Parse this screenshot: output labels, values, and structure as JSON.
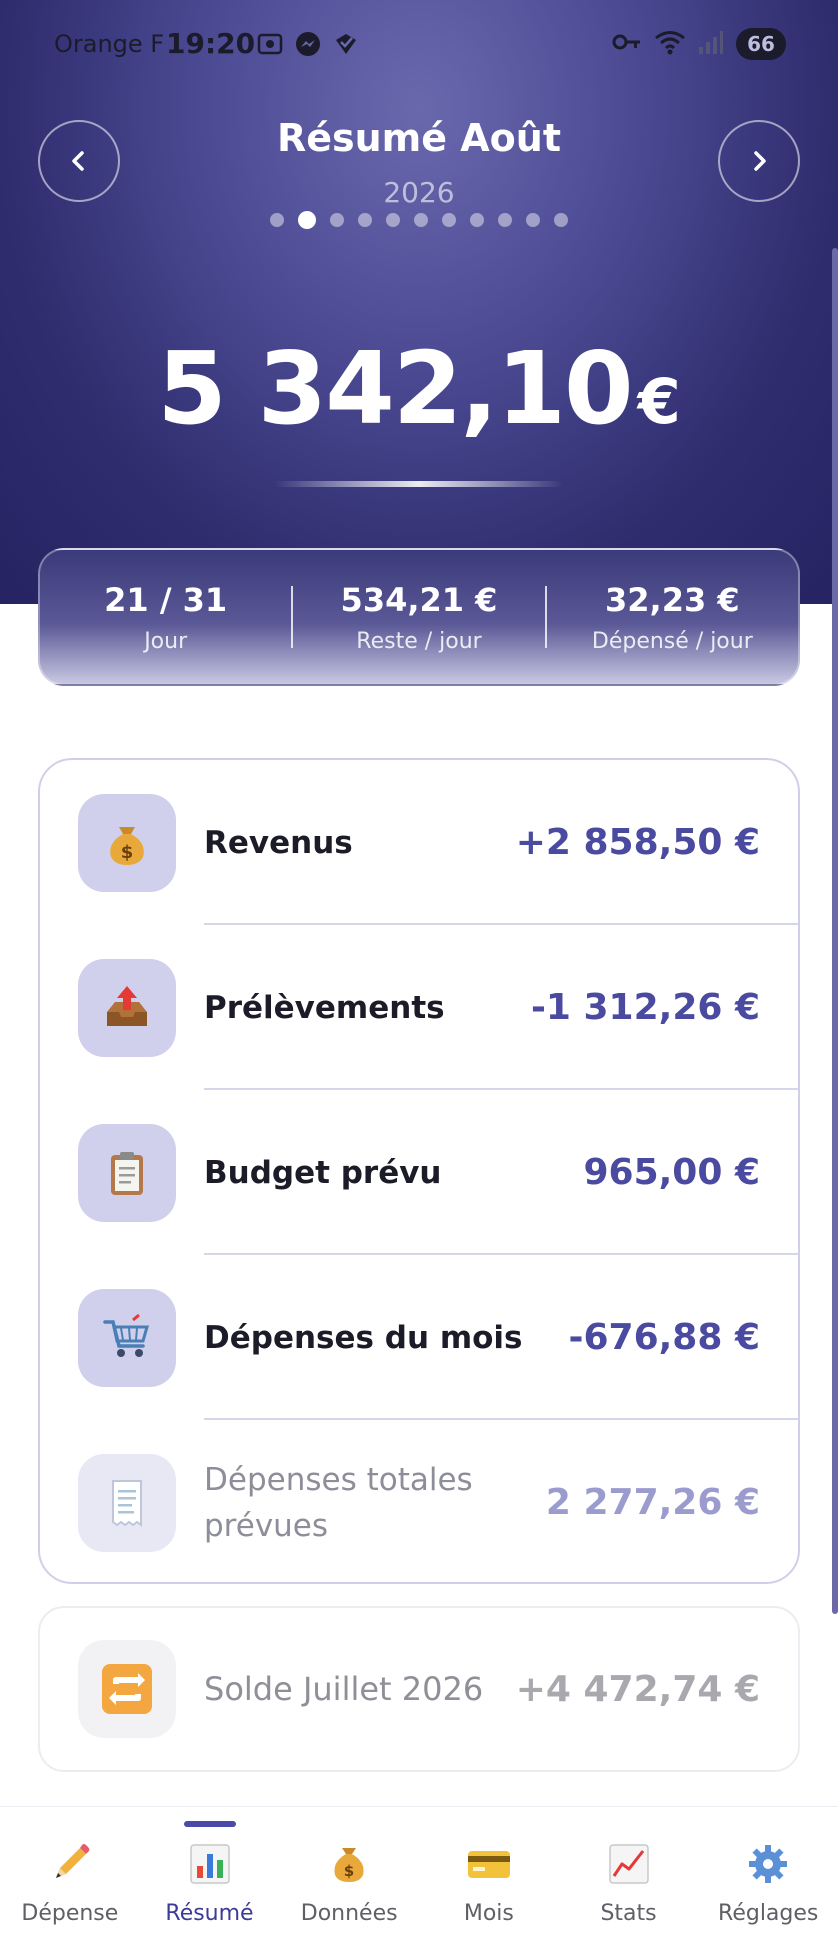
{
  "status_bar": {
    "carrier": "Orange F",
    "time": "19:20",
    "battery": "66"
  },
  "header": {
    "title": "Résumé Août",
    "year": "2026",
    "page_dots": 11,
    "active_dot": 1,
    "amount": "5 342,10",
    "currency": "€"
  },
  "stats": [
    {
      "value": "21 / 31",
      "label": "Jour"
    },
    {
      "value": "534,21 €",
      "label": "Reste / jour"
    },
    {
      "value": "32,23 €",
      "label": "Dépensé / jour"
    }
  ],
  "summary": [
    {
      "label": "Revenus",
      "value": "+2 858,50 €",
      "icon": "money-bag-icon"
    },
    {
      "label": "Prélèvements",
      "value": "-1 312,26 €",
      "icon": "outbox-tray-icon"
    },
    {
      "label": "Budget prévu",
      "value": "965,00 €",
      "icon": "clipboard-icon"
    },
    {
      "label": "Dépenses du mois",
      "value": "-676,88 €",
      "icon": "shopping-cart-icon"
    },
    {
      "label": "Dépenses totales prévues",
      "value": "2 277,26 €",
      "icon": "receipt-icon"
    }
  ],
  "solde": {
    "label": "Solde Juillet 2026",
    "value": "+4 472,74 €",
    "icon": "repeat-icon"
  },
  "bottom_nav": [
    {
      "label": "Dépense",
      "icon": "pencil-icon"
    },
    {
      "label": "Résumé",
      "icon": "bar-chart-icon",
      "active": true
    },
    {
      "label": "Données",
      "icon": "money-bag-icon"
    },
    {
      "label": "Mois",
      "icon": "credit-card-icon"
    },
    {
      "label": "Stats",
      "icon": "line-chart-icon"
    },
    {
      "label": "Réglages",
      "icon": "gear-icon"
    }
  ],
  "colors": {
    "header_dark": "#252361",
    "header_light": "#6a68ad",
    "accent": "#4a4aa0",
    "icon_bg": "#d1d0ec"
  }
}
